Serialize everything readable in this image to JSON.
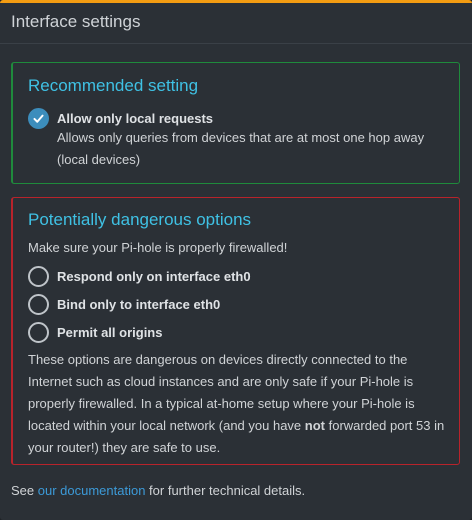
{
  "header": {
    "title": "Interface settings"
  },
  "recommended": {
    "title": "Recommended setting",
    "option": {
      "label": "Allow only local requests",
      "checked": true,
      "description": "Allows only queries from devices that are at most one hop away (local devices)"
    }
  },
  "dangerous": {
    "title": "Potentially dangerous options",
    "warning": "Make sure your Pi-hole is properly firewalled!",
    "options": [
      {
        "label": "Respond only on interface eth0",
        "checked": false
      },
      {
        "label": "Bind only to interface eth0",
        "checked": false
      },
      {
        "label": "Permit all origins",
        "checked": false
      }
    ],
    "note_before": "These options are dangerous on devices directly connected to the Internet such as cloud instances and are only safe if your Pi-hole is properly firewalled. In a typical at-home setup where your Pi-hole is located within your local network (and you have ",
    "note_bold": "not",
    "note_after": " forwarded port 53 in your router!) they are safe to use."
  },
  "footer": {
    "prefix": "See ",
    "link": "our documentation",
    "suffix": " for further technical details."
  },
  "colors": {
    "accent_top": "#f39c12",
    "title_cyan": "#3fc1e4",
    "success_border": "#1f8a3c",
    "danger_border": "#b8232b",
    "checkbox_blue": "#3c8dbc",
    "link": "#3c9ad8"
  }
}
